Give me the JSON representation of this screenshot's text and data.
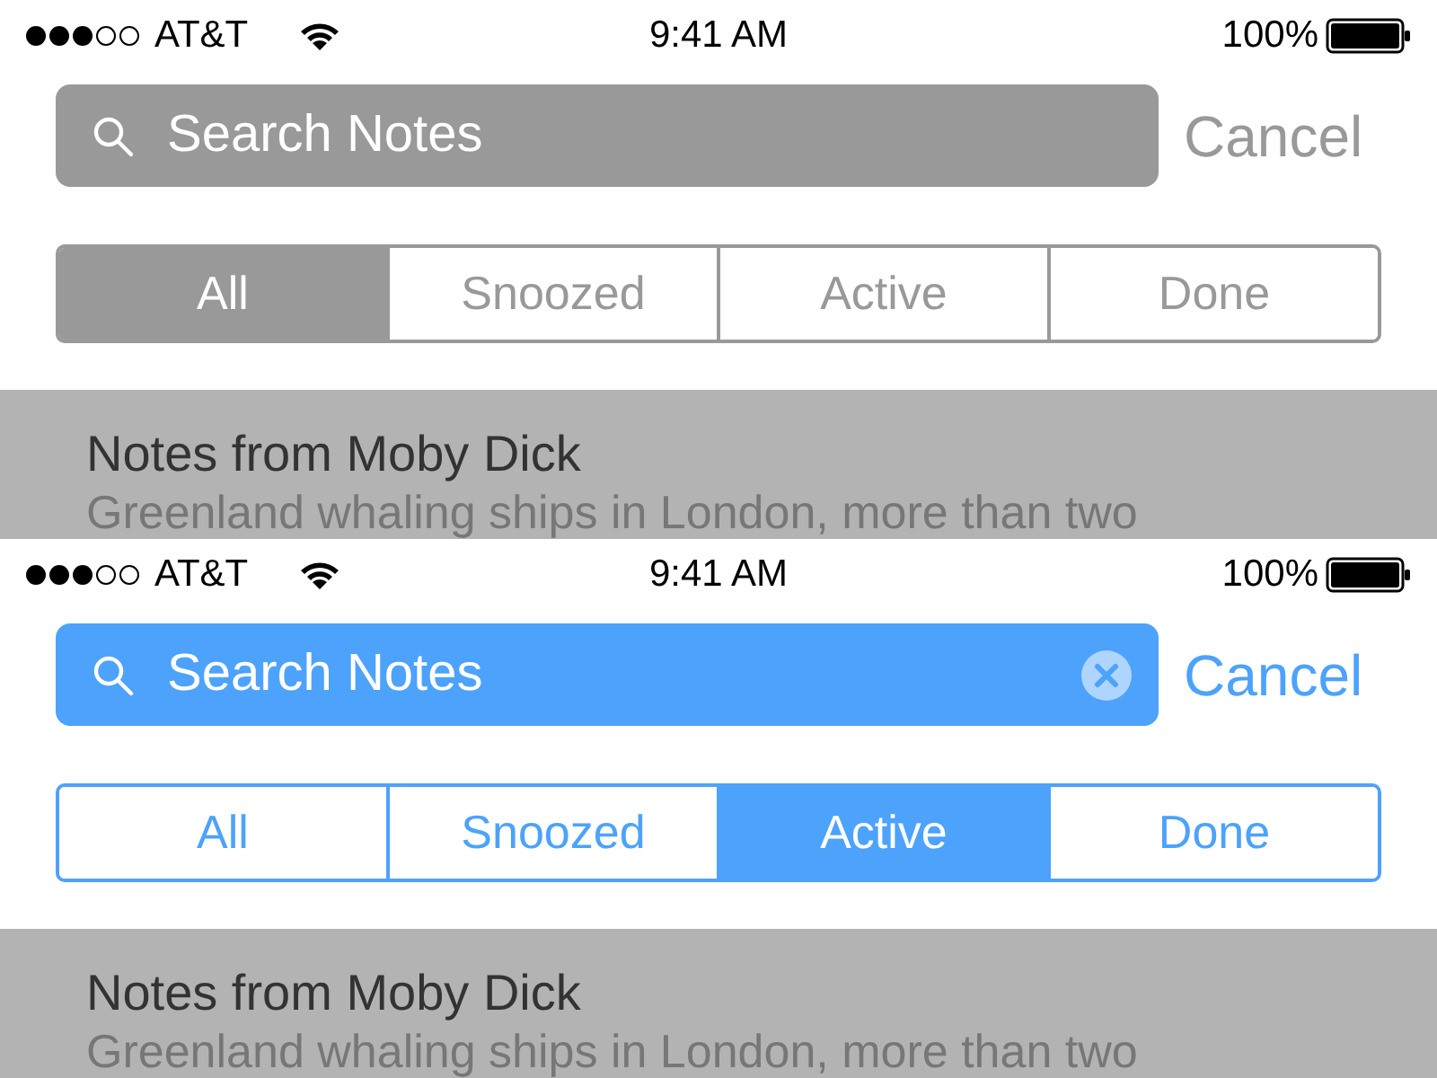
{
  "screens": [
    {
      "status_bar": {
        "carrier": "AT&T",
        "time": "9:41 AM",
        "battery": "100%"
      },
      "search": {
        "placeholder": "Search Notes",
        "focused": false,
        "clear_button": false
      },
      "cancel": "Cancel",
      "segments": [
        {
          "label": "All",
          "selected": true
        },
        {
          "label": "Snoozed",
          "selected": false
        },
        {
          "label": "Active",
          "selected": false
        },
        {
          "label": "Done",
          "selected": false
        }
      ],
      "note": {
        "title": "Notes from Moby Dick",
        "preview": "Greenland whaling ships in London, more than two"
      }
    },
    {
      "status_bar": {
        "carrier": "AT&T",
        "time": "9:41 AM",
        "battery": "100%"
      },
      "search": {
        "placeholder": "Search Notes",
        "focused": true,
        "clear_button": true
      },
      "cancel": "Cancel",
      "segments": [
        {
          "label": "All",
          "selected": false
        },
        {
          "label": "Snoozed",
          "selected": false
        },
        {
          "label": "Active",
          "selected": true
        },
        {
          "label": "Done",
          "selected": false
        }
      ],
      "note": {
        "title": "Notes from Moby Dick",
        "preview": "Greenland whaling ships in London, more than two"
      }
    }
  ]
}
